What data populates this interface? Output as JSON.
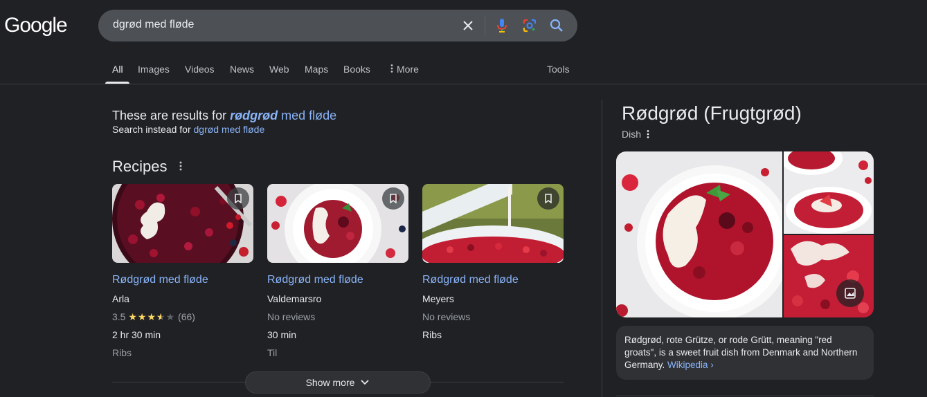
{
  "logo": "Google",
  "search": {
    "query": "dgrød med fløde",
    "icons": [
      "close-icon",
      "microphone-icon",
      "google-lens-icon",
      "search-icon"
    ]
  },
  "tabs": [
    {
      "label": "All",
      "active": true
    },
    {
      "label": "Images"
    },
    {
      "label": "Videos"
    },
    {
      "label": "News"
    },
    {
      "label": "Web"
    },
    {
      "label": "Maps"
    },
    {
      "label": "Books"
    },
    {
      "label": "More"
    }
  ],
  "tools_label": "Tools",
  "correction": {
    "prefix": "These are results for ",
    "corrected_word": "rødgrød",
    "rest": " med fløde",
    "instead_prefix": "Search instead for ",
    "instead_query": "dgrød med fløde"
  },
  "recipes": {
    "title": "Recipes",
    "show_more_label": "Show more",
    "cards": [
      {
        "title": "Rødgrød med fløde",
        "source": "Arla",
        "rating_value": "3.5",
        "stars": 3.5,
        "rating_count": "(66)",
        "time": "2 hr 30 min",
        "category": "Ribs"
      },
      {
        "title": "Rødgrød med fløde",
        "source": "Valdemarsro",
        "rating_text": "No reviews",
        "time": "30 min",
        "category": "Til"
      },
      {
        "title": "Rødgrød med fløde",
        "source": "Meyers",
        "rating_text": "No reviews",
        "time": "",
        "category": "Ribs"
      }
    ]
  },
  "knowledge_panel": {
    "title": "Rødgrød (Frugtgrød)",
    "subtitle": "Dish",
    "description": "Rødgrød, rote Grütze, or rode Grütt, meaning \"red groats\", is a sweet fruit dish from Denmark and Northern Germany. ",
    "source_link": "Wikipedia ›"
  },
  "colors": {
    "background": "#202124",
    "link": "#8ab4f8",
    "text": "#e8eaed",
    "star": "#fdd663"
  }
}
